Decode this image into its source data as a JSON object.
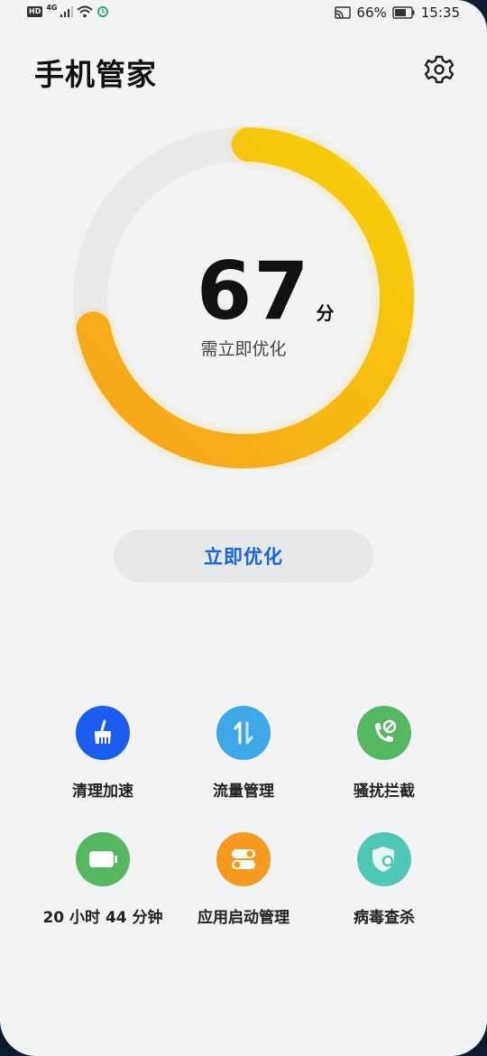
{
  "status_bar": {
    "hd": "HD",
    "network": "4G",
    "battery_percent": "66%",
    "time": "15:35"
  },
  "header": {
    "title": "手机管家"
  },
  "score": {
    "value": "67",
    "unit": "分",
    "status": "需立即优化",
    "fraction": 0.67
  },
  "actions": {
    "optimize_label": "立即优化"
  },
  "tools": [
    {
      "label": "清理加速",
      "icon": "broom-icon",
      "color": "#1a5cf0"
    },
    {
      "label": "流量管理",
      "icon": "data-transfer-icon",
      "color": "#3ea8e6"
    },
    {
      "label": "骚扰拦截",
      "icon": "call-block-icon",
      "color": "#55b75f"
    },
    {
      "label": "20 小时 44 分钟",
      "icon": "battery-icon",
      "color": "#55b75f"
    },
    {
      "label": "应用启动管理",
      "icon": "toggle-switch-icon",
      "color": "#f59a1e"
    },
    {
      "label": "病毒查杀",
      "icon": "shield-search-icon",
      "color": "#4fc7b4"
    }
  ],
  "colors": {
    "accent": "#1665e8",
    "gauge_start": "#f6a21c",
    "gauge_end": "#f7cd0d",
    "gauge_track": "#e9eaec"
  }
}
